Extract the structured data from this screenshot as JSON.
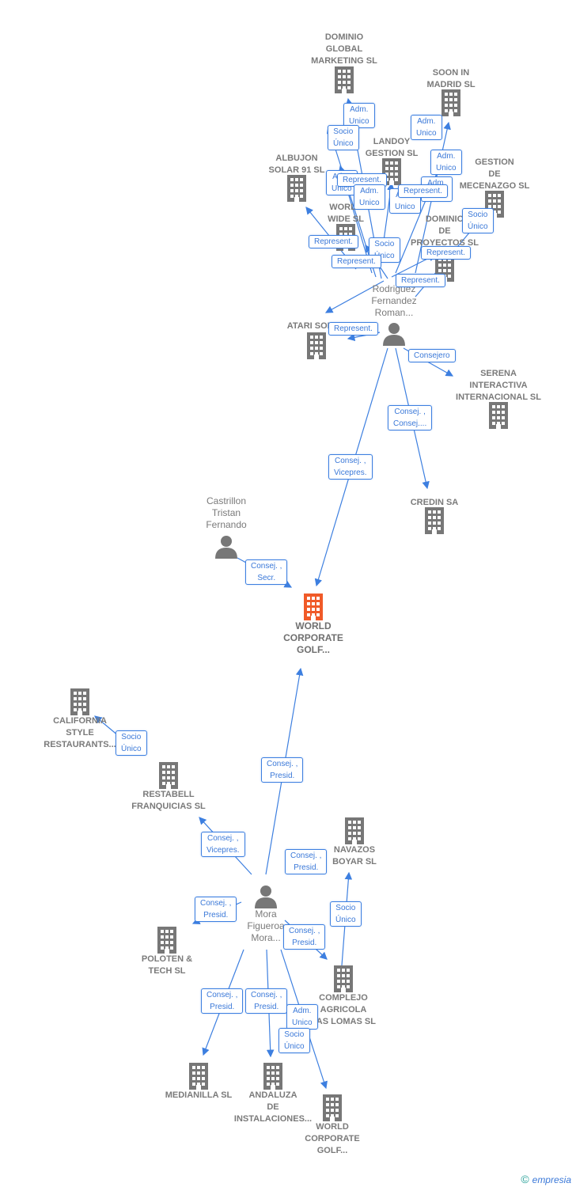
{
  "colors": {
    "edge": "#3d7fe0",
    "node": "#777777",
    "focus": "#f05a28"
  },
  "nodes": [
    {
      "label": "DOMINIO\nGLOBAL\nMARKETING SL",
      "type": "company"
    },
    {
      "label": "SOON IN\nMADRID SL",
      "type": "company"
    },
    {
      "label": "LANDOY\nGESTION  SL",
      "type": "company"
    },
    {
      "label": "ALBUJON\nSOLAR 91 SL",
      "type": "company"
    },
    {
      "label": "GESTION\nDE\nMECENAZGO SL",
      "type": "company"
    },
    {
      "label": "WORLD\nWIDE  SL",
      "type": "company"
    },
    {
      "label": "DOMINIO\nDE\nPROYECTOS SL",
      "type": "company"
    },
    {
      "label": "Rodriguez\nFernandez\nRoman...",
      "type": "person"
    },
    {
      "label": "ATARI SOL SL",
      "type": "company"
    },
    {
      "label": "SERENA\nINTERACTIVA\nINTERNACIONAL SL",
      "type": "company"
    },
    {
      "label": "CREDIN SA",
      "type": "company"
    },
    {
      "label": "Castrillon\nTristan\nFernando",
      "type": "person"
    },
    {
      "label": "WORLD\nCORPORATE\nGOLF...",
      "type": "focus"
    },
    {
      "label": "CALIFORNIA\nSTYLE\nRESTAURANTS...",
      "type": "company"
    },
    {
      "label": "RESTABELL\nFRANQUICIAS SL",
      "type": "company"
    },
    {
      "label": "NAVAZOS\nBOYAR SL",
      "type": "company"
    },
    {
      "label": "Mora\nFigueroa\nMora...",
      "type": "person"
    },
    {
      "label": "POLOTEN &\nTECH  SL",
      "type": "company"
    },
    {
      "label": "COMPLEJO\nAGRICOLA\nLAS LOMAS  SL",
      "type": "company"
    },
    {
      "label": "MEDIANILLA SL",
      "type": "company"
    },
    {
      "label": "ANDALUZA\nDE\nINSTALACIONES...",
      "type": "company"
    },
    {
      "label": "WORLD\nCORPORATE\nGOLF...",
      "type": "company"
    }
  ],
  "edge_labels": [
    "Adm.\nUnico",
    "Socio\nÚnico",
    "Adm.\nUnico",
    "Adm.\nUnico",
    "Adm.\nUnico",
    "Represent.",
    "Adm.\nUnico",
    "Adm.\nUnico",
    "Adm.\nUnico",
    "Represent.",
    "Socio\nÚnico",
    "Represent.",
    "Socio\nÚnico",
    "Represent.",
    "Represent.",
    "Represent.",
    "Represent.",
    "Consejero",
    "Consej. ,\nConsej....",
    "Consej. ,\nVicepres.",
    "Consej. ,\nSecr.",
    "Socio\nÚnico",
    "Consej. ,\nPresid.",
    "Consej. ,\nVicepres.",
    "Consej. ,\nPresid.",
    "Consej. ,\nPresid.",
    "Socio\nÚnico",
    "Consej. ,\nPresid.",
    "Consej. ,\nPresid.",
    "Consej. ,\nPresid.",
    "Adm.\nUnico",
    "Socio\nÚnico"
  ],
  "footer": {
    "copyright": "©",
    "brand": "empresia"
  }
}
